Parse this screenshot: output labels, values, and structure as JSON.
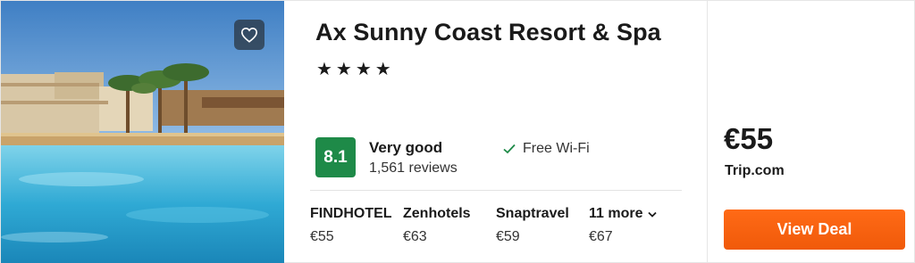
{
  "hotel": {
    "name": "Ax Sunny Coast Resort & Spa",
    "stars": "★★★★",
    "rating_score": "8.1",
    "rating_label": "Very good",
    "review_count": "1,561 reviews",
    "amenity": "Free Wi-Fi",
    "photo_icon": "heart-icon"
  },
  "providers": [
    {
      "name": "FINDHOTEL",
      "price": "€55"
    },
    {
      "name": "Zenhotels",
      "price": "€63"
    },
    {
      "name": "Snaptravel",
      "price": "€59"
    }
  ],
  "more_providers": {
    "label": "11 more",
    "price": "€67"
  },
  "deal": {
    "price": "€55",
    "site": "Trip.com",
    "button_label": "View Deal"
  },
  "colors": {
    "rating_badge": "#1e8a48",
    "button": "#f05a0a",
    "check": "#1e8a48"
  }
}
